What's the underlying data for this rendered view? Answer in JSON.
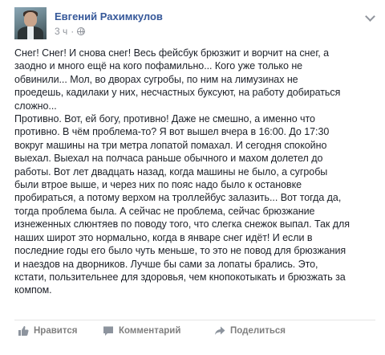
{
  "post": {
    "author": "Евгений Рахимкулов",
    "time": "3 ч",
    "separator": "·",
    "privacy_icon": "globe-icon",
    "options_icon": "chevron-down-icon",
    "text": "Снег! Снег! И снова снег! Весь фейсбук брюзжит и ворчит на снег, а\nзаодно и много ещё на кого пофамильно... Кого уже только не\nобвинили... Мол, во дворах сугробы, по ним на лимузинах не\nпроедешь, кадилаки у них, несчастных буксуют, на работу добираться\nсложно...\nПротивно. Вот, ей богу, противно! Даже не смешно, а именно что\nпротивно. В чём проблема-то? Я вот вышел вчера в 16:00. До 17:30\nвокруг машины на три метра лопатой помахал. И сегодня спокойно\nвыехал. Выехал на полчаса раньше обычного и махом долетел до\nработы. Вот лет двадцать назад, когда машины не было, а сугробы\nбыли втрое выше, и через них по пояс надо было к остановке\nпробираться, а потому верхом на троллейбус залазить... Вот тогда да,\nтогда проблема была. А сейчас не проблема, сейчас брюзжание\nизнеженных слюнтяев по поводу того, что слегка снежок выпал. Так для\nнаших широт это нормально, когда в январе снег идёт! И если в\nпоследние годы его было чуть меньше, то это не повод для брюзжания\nи наездов на дворников. Лучше бы сами за лопаты брались. Это,\nкстати, пользительнее для здоровья, чем кнопокотыкать и брюзжать за\nкомпом."
  },
  "actions": {
    "like": "Нравится",
    "comment": "Комментарий",
    "share": "Поделиться"
  }
}
